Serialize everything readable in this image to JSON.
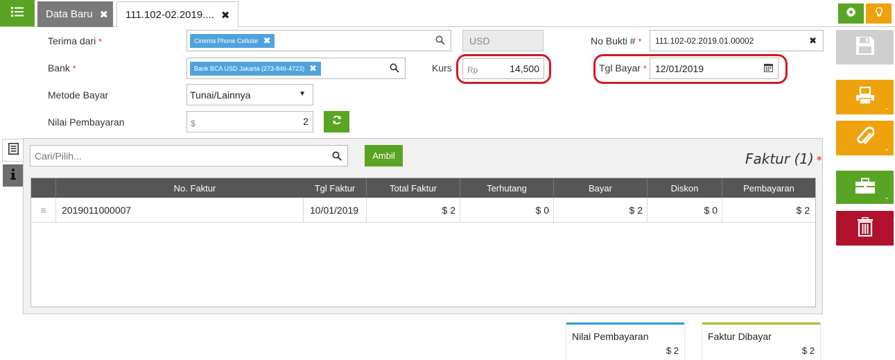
{
  "tabs": [
    {
      "label": "Data Baru"
    },
    {
      "label": "111.102-02.2019...."
    }
  ],
  "form": {
    "terima_dari_label": "Terima dari",
    "terima_dari_value": "Cinema Phone Cellular",
    "currency": "USD",
    "no_bukti_label": "No Bukti #",
    "no_bukti_value": "111.102-02.2019.01.00002",
    "bank_label": "Bank",
    "bank_value": "Bank BCA USD Jakarta (273-846-4723)",
    "kurs_label": "Kurs",
    "kurs_prefix": "Rp",
    "kurs_value": "14,500",
    "tgl_bayar_label": "Tgl Bayar",
    "tgl_bayar_value": "12/01/2019",
    "metode_label": "Metode Bayar",
    "metode_value": "Tunai/Lainnya",
    "nilai_label": "Nilai Pembayaran",
    "nilai_prefix": "$",
    "nilai_value": "2",
    "required_mark": "*"
  },
  "search": {
    "placeholder": "Cari/Pilih...",
    "ambil_label": "Ambil"
  },
  "faktur": {
    "title": "Faktur (1)",
    "required_mark": "*"
  },
  "table": {
    "columns": [
      "No. Faktur",
      "Tgl Faktur",
      "Total Faktur",
      "Terhutang",
      "Bayar",
      "Diskon",
      "Pembayaran"
    ],
    "rows": [
      {
        "no_faktur": "2019011000007",
        "tgl_faktur": "10/01/2019",
        "total_faktur": "$ 2",
        "terhutang": "$ 0",
        "bayar": "$ 2",
        "diskon": "$ 0",
        "pembayaran": "$ 2"
      }
    ]
  },
  "summary": {
    "nilai_pembayaran_label": "Nilai Pembayaran",
    "nilai_pembayaran_value": "$ 2",
    "faktur_dibayar_label": "Faktur Dibayar",
    "faktur_dibayar_value": "$ 2"
  },
  "icons": {
    "menu": "list-menu-icon",
    "close": "close-icon",
    "settings": "gear-icon",
    "tips": "lightbulb-icon",
    "save": "floppy-disk-icon",
    "print": "printer-icon",
    "attach": "paperclip-icon",
    "briefcase": "briefcase-icon",
    "delete": "trash-icon",
    "calendar": "calendar-icon",
    "search": "search-icon",
    "refresh": "refresh-icon",
    "doc": "document-list-icon",
    "info": "info-icon"
  },
  "colors": {
    "green": "#5aa423",
    "orange": "#f0a20d",
    "red": "#b0122b",
    "gray_tab": "#7a7a7a",
    "tag_blue": "#4fa3dd",
    "header_dark": "#565656",
    "card_blue": "#2f9fd8",
    "card_olive": "#a9c233",
    "highlight_red": "#d11a25"
  }
}
